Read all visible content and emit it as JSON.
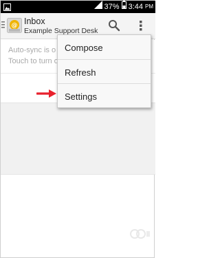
{
  "status_bar": {
    "battery_percent": "37%",
    "time": "3:44",
    "am_pm": "PM",
    "icons": [
      "image-notification-icon",
      "signal-icon",
      "battery-icon"
    ]
  },
  "action_bar": {
    "title": "Inbox",
    "subtitle": "Example Support Desk",
    "icons": [
      "drawer-icon",
      "mail-logo-icon",
      "search-icon",
      "overflow-menu-icon"
    ]
  },
  "sync_notice": {
    "line1": "Auto-sync is o",
    "line2": "Touch to turn o"
  },
  "menu": {
    "items": [
      {
        "label": "Compose"
      },
      {
        "label": "Refresh"
      },
      {
        "label": "Settings"
      }
    ]
  },
  "annotation": {
    "arrow_color": "#e8212d",
    "points_to": "Settings"
  },
  "colors": {
    "status_bar": "#000000",
    "action_bar": "#f4f4f4",
    "menu_bg": "#f8f8f8",
    "notice_text": "#a9a9a9",
    "logo": "#f0b400"
  }
}
